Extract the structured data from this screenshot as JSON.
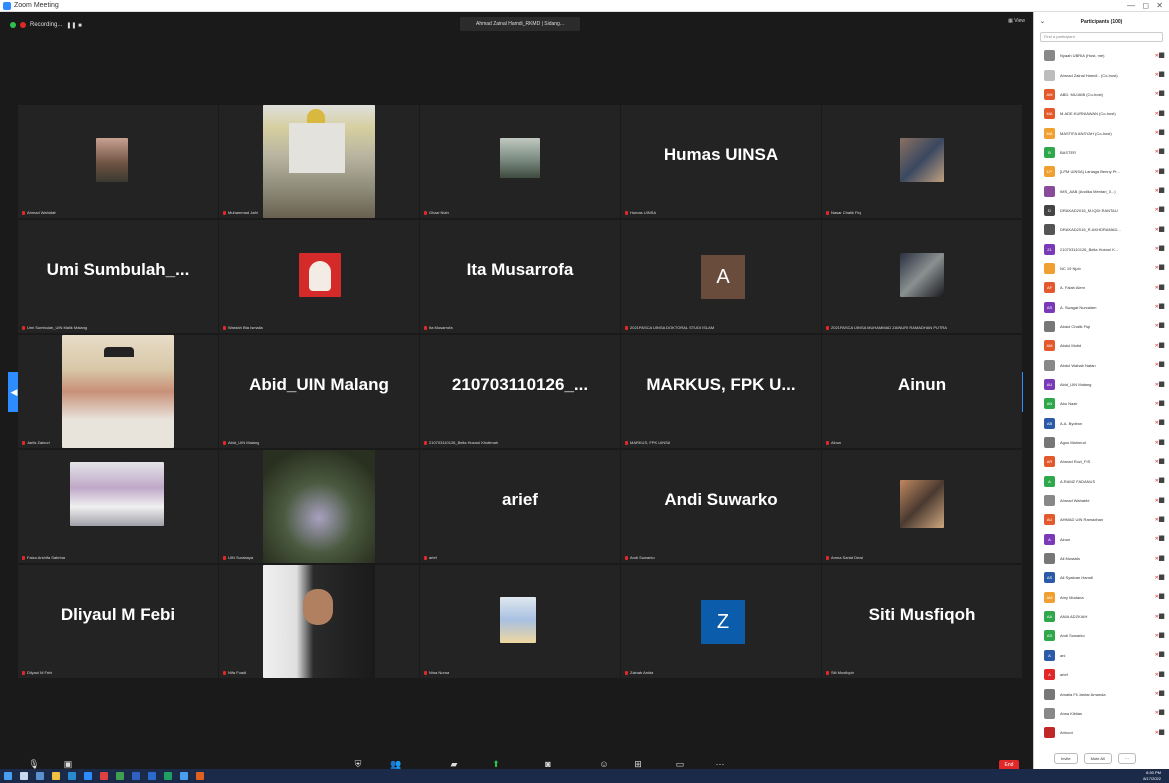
{
  "window": {
    "title": "Zoom Meeting"
  },
  "topbar": {
    "recording": "Recording...",
    "active_speaker": "Ahmad Zainal Hamdi_RKMD | Sidang...",
    "view": "View"
  },
  "tiles": [
    {
      "big": "",
      "label": "Ahmad Wahidah"
    },
    {
      "big": "",
      "label": "Muhammad Jafri"
    },
    {
      "big": "",
      "label": "Ghazi Nizbi"
    },
    {
      "big": "Humas UINSA",
      "label": "Humas UINSA"
    },
    {
      "big": "",
      "label": "Nasar Chalik Fiqi"
    },
    {
      "big": "Umi  Sumbulah_...",
      "label": "Umi Sumbulah_UIN Malik Malang"
    },
    {
      "big": "",
      "label": "Wardah Bta Ismaila"
    },
    {
      "big": "Ita Musarrofa",
      "label": "Ita Musarrofa"
    },
    {
      "big": "A",
      "label": "2021PASCA UINSA DOKTORAL STUDI ISLAM"
    },
    {
      "big": "",
      "label": "2021PASCA UINSA MUHAMMAD ZAINURI RAMADHAN PUTRA"
    },
    {
      "big": "",
      "label": "Jarlis Zainuri"
    },
    {
      "big": "Abid_UIN Malang",
      "label": "Abid_UIN Malang"
    },
    {
      "big": "210703110126_...",
      "label": "210703110126_Bella Husnul Khotimah"
    },
    {
      "big": "MARKUS, FPK U...",
      "label": "MARKUS, FPK UINSA"
    },
    {
      "big": "Ainun",
      "label": "Ainun"
    },
    {
      "big": "",
      "label": "Faiza Arshifa Sabrina"
    },
    {
      "big": "",
      "label": "UIN Surabaya"
    },
    {
      "big": "arief",
      "label": "arief"
    },
    {
      "big": "Andi Suwarko",
      "label": "Andi Suwarko"
    },
    {
      "big": "",
      "label": "Amna Sariat Dewi"
    },
    {
      "big": "Dliyaul M Febi",
      "label": "Dliyaul M Febi"
    },
    {
      "big": "",
      "label": "Nifa Fuadi"
    },
    {
      "big": "",
      "label": "Nina Nurna"
    },
    {
      "big": "Z",
      "label": "Zainab Anida"
    },
    {
      "big": "Siti Musfiqoh",
      "label": "Siti Musfiqoh"
    }
  ],
  "toolbar": {
    "mute": "Mute",
    "video": "Start Video",
    "security": "Security",
    "participants": "Participants",
    "chat": "Chat",
    "share": "Share Screen",
    "record": "Recording Recording",
    "reactions": "Reactions",
    "apps": "Apps",
    "whiteboards": "Whiteboards",
    "more": "More",
    "end": "End"
  },
  "panel": {
    "title": "Participants (100)",
    "search_placeholder": "Find a participant",
    "invite": "Invite",
    "mute_all": "Mute All",
    "participants": [
      {
        "name": "Nyaah UBRIA (Host, me)",
        "color": "#888888",
        "initials": ""
      },
      {
        "name": "Ahmad Zainal Hamdi - (Co-host)",
        "color": "#bdbdbd",
        "initials": ""
      },
      {
        "name": "ABD. MUJAIB (Co-host)",
        "color": "#e3592b",
        "initials": "AM"
      },
      {
        "name": "M.ADE.KURNIAWAN (Co-host)",
        "color": "#e3592b",
        "initials": "MA"
      },
      {
        "name": "MASTIFA ANSYAH (Co-host)",
        "color": "#f0a030",
        "initials": "MA"
      },
      {
        "name": "BASTER",
        "color": "#2ea84a",
        "initials": "B"
      },
      {
        "name": "[LPM UINSA] Laniaga Benny Pr...",
        "color": "#f0a030",
        "initials": "LP"
      },
      {
        "name": "IMS_AAB (Andika Mentari_0...)",
        "color": "#8a4a9a",
        "initials": ""
      },
      {
        "name": "DRAKAD2016_M.IQDI.RANTAU",
        "color": "#444444",
        "initials": "D"
      },
      {
        "name": "DRAKAD2016_R.AKHDRAMAD...",
        "color": "#555555",
        "initials": ""
      },
      {
        "name": "210703110126_Bella Husnul K...",
        "color": "#7a3ab8",
        "initials": "21"
      },
      {
        "name": "NC 19 Njob",
        "color": "#f0a030",
        "initials": ""
      },
      {
        "name": "A. Falah Alem",
        "color": "#e3592b",
        "initials": "AF"
      },
      {
        "name": "A. Swagat Nurcalam",
        "color": "#7a3ab8",
        "initials": "AS"
      },
      {
        "name": "Abdul Chalik Fiqi",
        "color": "#777777",
        "initials": ""
      },
      {
        "name": "Abdul Mutid",
        "color": "#e3592b",
        "initials": "AM"
      },
      {
        "name": "Abdul Wahab Nafan",
        "color": "#888888",
        "initials": ""
      },
      {
        "name": "Abid_UIN Malang",
        "color": "#7a3ab8",
        "initials": "AU"
      },
      {
        "name": "Abu Nazir",
        "color": "#2ea84a",
        "initials": "AN"
      },
      {
        "name": "A.A. Bydeon",
        "color": "#2a5aa8",
        "initials": "AB"
      },
      {
        "name": "Agus Mahmud",
        "color": "#777777",
        "initials": ""
      },
      {
        "name": "Ahmad Rozi_FIS",
        "color": "#e3592b",
        "initials": "AR"
      },
      {
        "name": "A.RAMZ FADANUS",
        "color": "#2ea84a",
        "initials": "A"
      },
      {
        "name": "Ahmad Wahabbi",
        "color": "#888888",
        "initials": ""
      },
      {
        "name": "AHMAD UIN Ramadhan",
        "color": "#e3592b",
        "initials": "AU"
      },
      {
        "name": "Ainun",
        "color": "#7a3ab8",
        "initials": "A"
      },
      {
        "name": "Ali Mustafa",
        "color": "#777777",
        "initials": ""
      },
      {
        "name": "Ali Syakran Hamdi",
        "color": "#2a5aa8",
        "initials": "AS"
      },
      {
        "name": "Amy Mudana",
        "color": "#f0a030",
        "initials": "AM"
      },
      {
        "name": "ANIA ADZKIAH",
        "color": "#2ea84a",
        "initials": "AA"
      },
      {
        "name": "Andi Suwarko",
        "color": "#2ea84a",
        "initials": "AS"
      },
      {
        "name": "ani",
        "color": "#2a5aa8",
        "initials": "A"
      },
      {
        "name": "arief",
        "color": "#e02828",
        "initials": "A"
      },
      {
        "name": "Amalia Fil Jantar Amanda",
        "color": "#777777",
        "initials": ""
      },
      {
        "name": "Arwa Kiblias",
        "color": "#888888",
        "initials": ""
      },
      {
        "name": "Arinoot",
        "color": "#c02828",
        "initials": ""
      }
    ]
  },
  "taskbar": {
    "time": "8:30 PM",
    "date": "8/17/2022"
  }
}
